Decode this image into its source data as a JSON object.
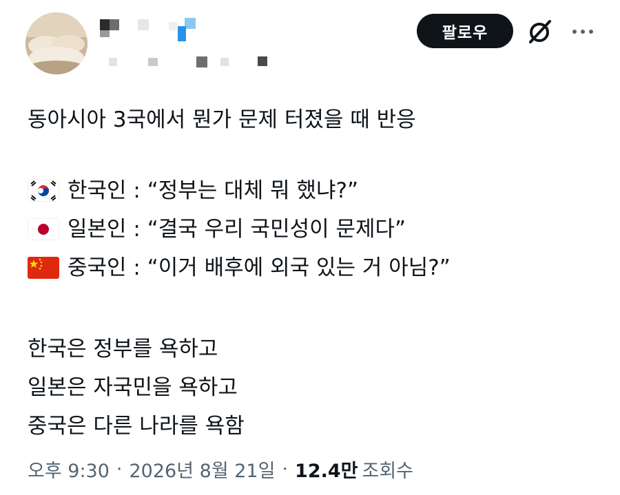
{
  "header": {
    "follow_label": "팔로우",
    "grok_icon": "grok-icon",
    "more_icon": "more-icon"
  },
  "tweet": {
    "line1": "동아시아 3국에서 뭔가 문제 터졌을 때 반응",
    "korea": {
      "flag": "korea-flag-icon",
      "text": "한국인 : “정부는 대체 뭐 했냐?”"
    },
    "japan": {
      "flag": "japan-flag-icon",
      "text": "일본인 : “결국 우리 국민성이 문제다”"
    },
    "china": {
      "flag": "china-flag-icon",
      "text": "중국인 : “이거 배후에 외국 있는 거 아님?”"
    },
    "summary1": "한국은 정부를 욕하고",
    "summary2": "일본은 자국민을 욕하고",
    "summary3": "중국은 다른 나라를 욕함"
  },
  "meta": {
    "time": "오후 9:30",
    "date": "2026년 8월 21일",
    "views_count": "12.4만",
    "views_label": "조회수"
  }
}
